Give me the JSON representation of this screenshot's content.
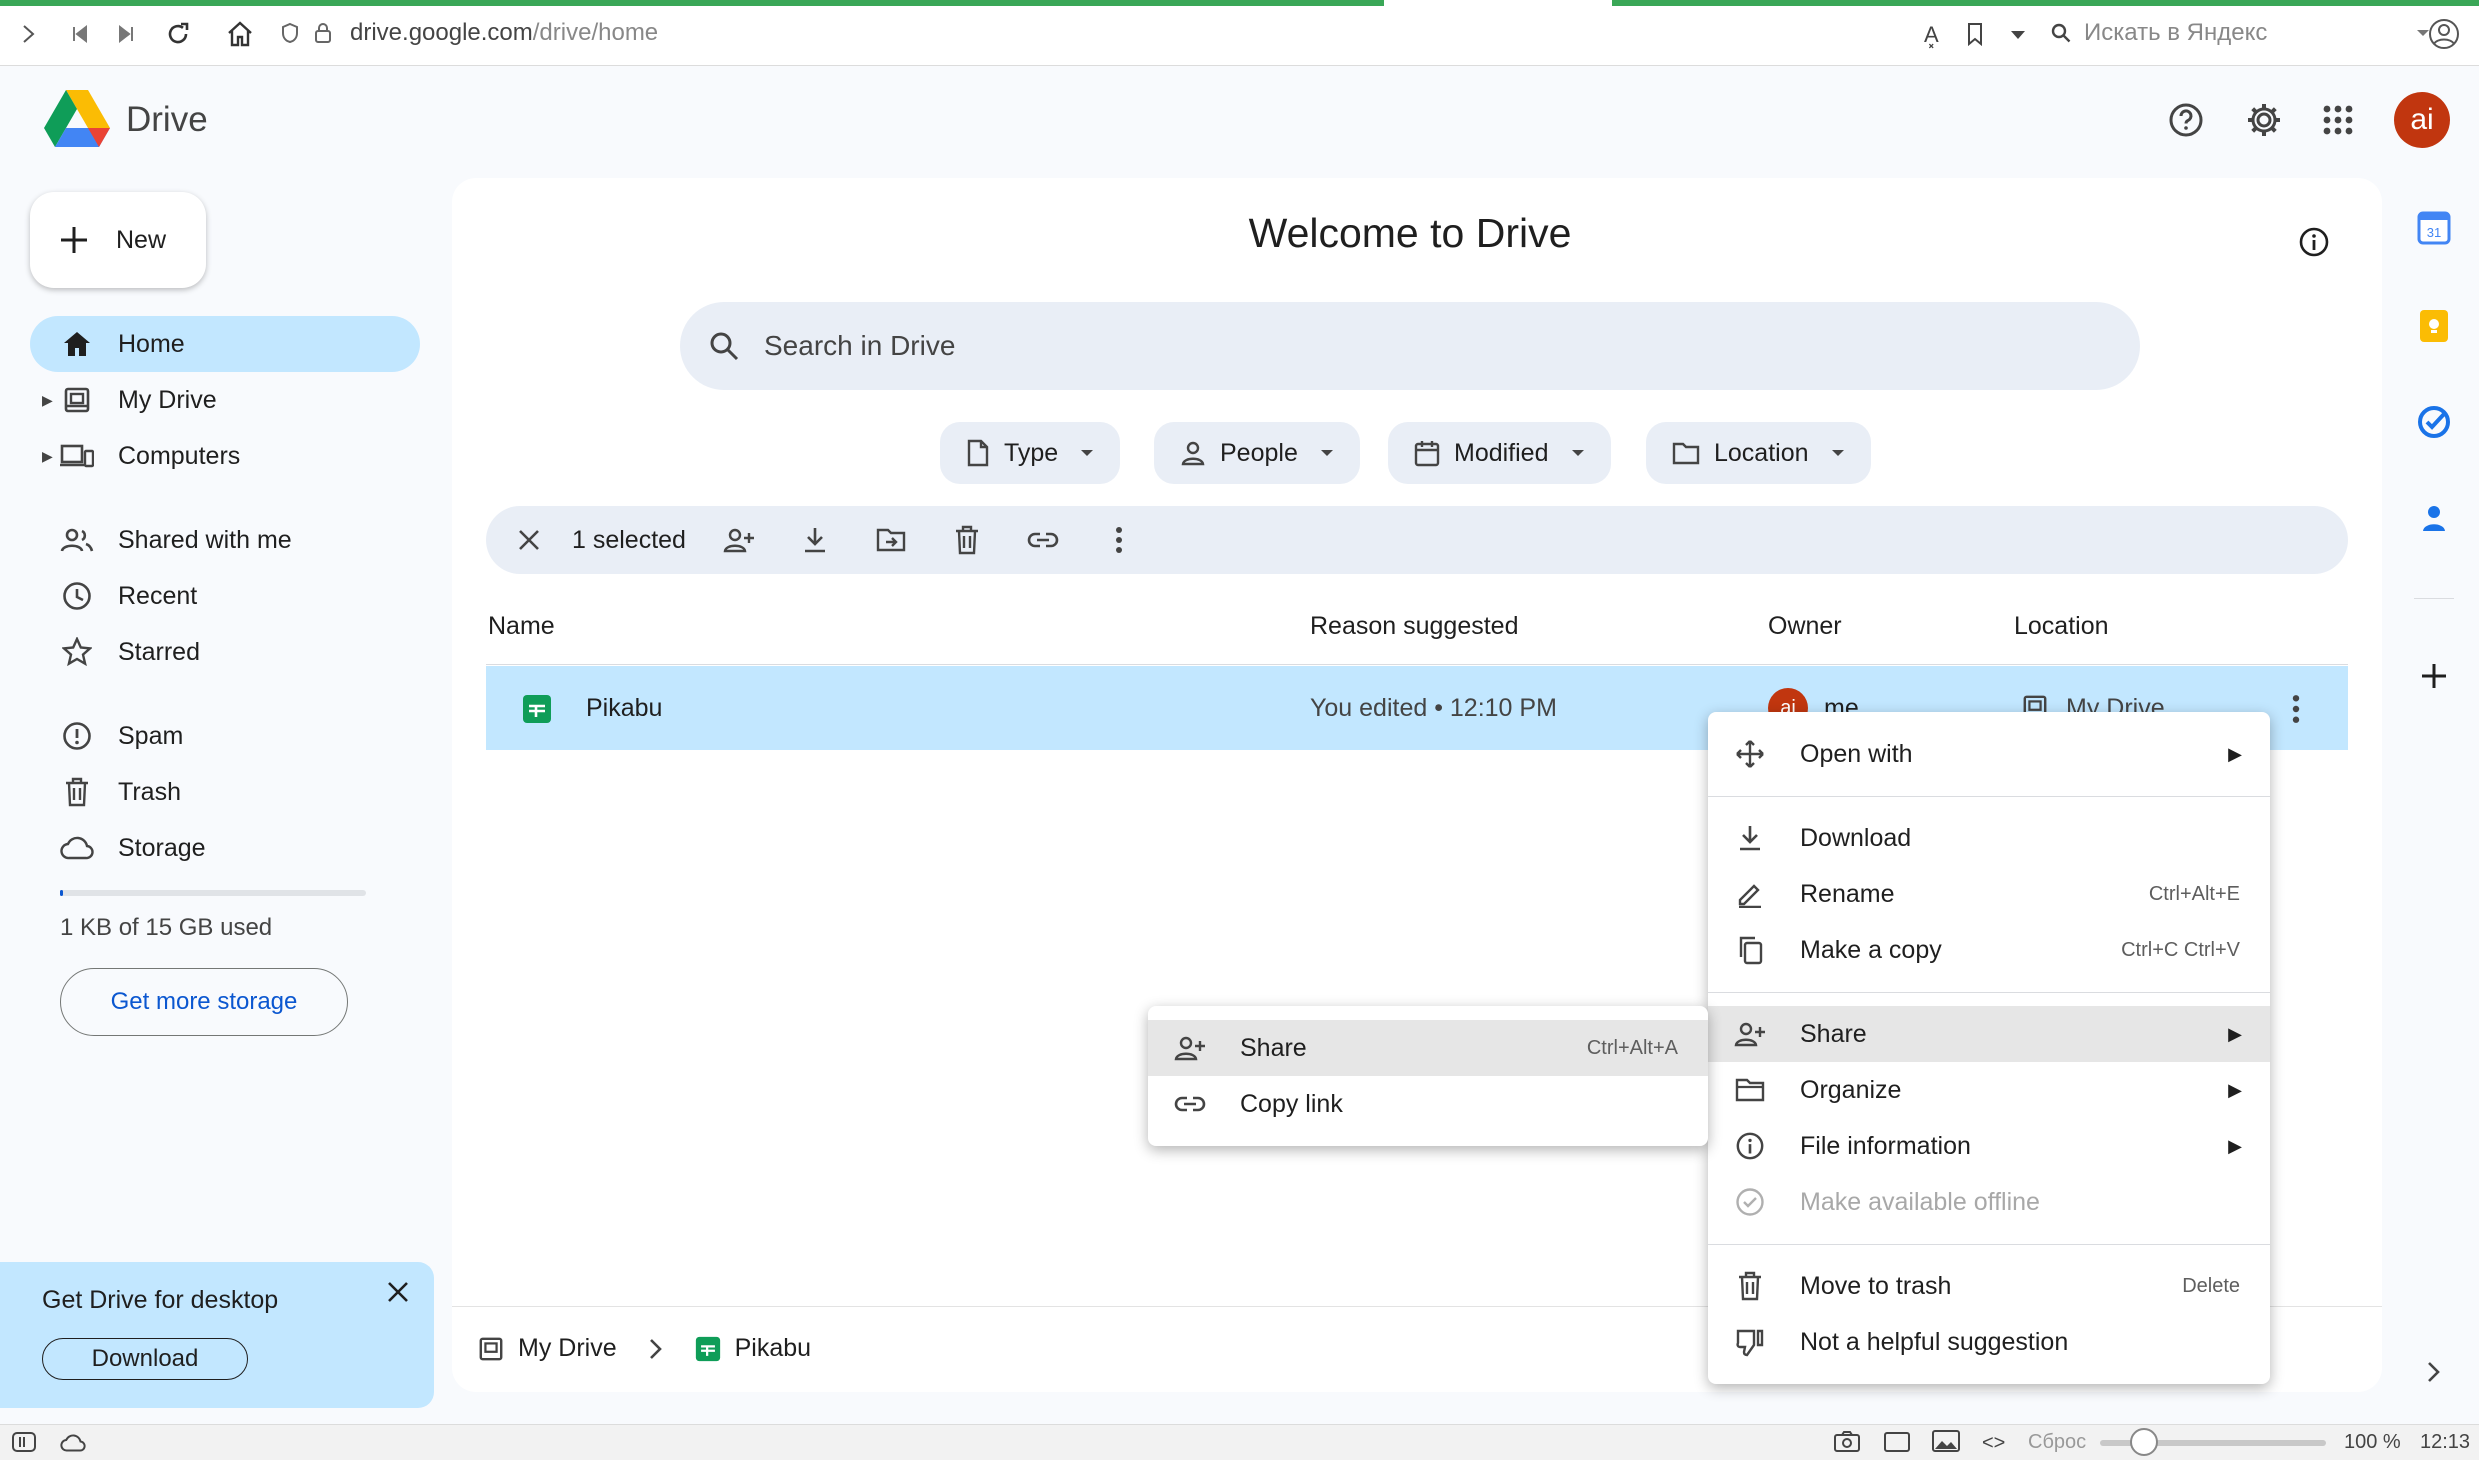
{
  "browser": {
    "url_prefix": "drive.google.com",
    "url_path": "/drive/home",
    "search_placeholder": "Искать в Яндекс",
    "status": {
      "reset": "Сброс",
      "zoom": "100 %",
      "clock": "12:13"
    }
  },
  "header": {
    "app_name": "Drive",
    "avatar_initials": "ai"
  },
  "sidebar": {
    "new_label": "New",
    "items": [
      {
        "label": "Home",
        "icon": "home-icon"
      },
      {
        "label": "My Drive",
        "icon": "my-drive-icon"
      },
      {
        "label": "Computers",
        "icon": "computers-icon"
      },
      {
        "label": "Shared with me",
        "icon": "shared-icon"
      },
      {
        "label": "Recent",
        "icon": "clock-icon"
      },
      {
        "label": "Starred",
        "icon": "star-icon"
      },
      {
        "label": "Spam",
        "icon": "spam-icon"
      },
      {
        "label": "Trash",
        "icon": "trash-icon"
      },
      {
        "label": "Storage",
        "icon": "cloud-icon"
      }
    ],
    "storage_used": "1 KB of 15 GB used",
    "get_more_storage": "Get more storage",
    "promo": {
      "title": "Get Drive for desktop",
      "download": "Download"
    }
  },
  "main": {
    "title": "Welcome to Drive",
    "search_placeholder": "Search in Drive",
    "filters": [
      "Type",
      "People",
      "Modified",
      "Location"
    ],
    "selection": {
      "count_label": "1 selected"
    },
    "columns": {
      "name": "Name",
      "reason": "Reason suggested",
      "owner": "Owner",
      "location": "Location"
    },
    "row": {
      "name": "Pikabu",
      "reason": "You edited • 12:10 PM",
      "owner_initials": "ai",
      "owner": "me",
      "location": "My Drive"
    },
    "breadcrumb": [
      "My Drive",
      "Pikabu"
    ]
  },
  "context_menu": {
    "items": [
      {
        "label": "Open with",
        "icon": "move-icon",
        "shortcut": ""
      },
      {
        "label": "Download",
        "icon": "download-icon",
        "shortcut": ""
      },
      {
        "label": "Rename",
        "icon": "rename-icon",
        "shortcut": "Ctrl+Alt+E"
      },
      {
        "label": "Make a copy",
        "icon": "copy-icon",
        "shortcut": "Ctrl+C Ctrl+V"
      },
      {
        "label": "Share",
        "icon": "share-icon",
        "shortcut": ""
      },
      {
        "label": "Organize",
        "icon": "folder-icon",
        "shortcut": ""
      },
      {
        "label": "File information",
        "icon": "info-icon",
        "shortcut": ""
      },
      {
        "label": "Make available offline",
        "icon": "offline-icon",
        "shortcut": ""
      },
      {
        "label": "Move to trash",
        "icon": "trash-icon",
        "shortcut": "Delete"
      },
      {
        "label": "Not a helpful suggestion",
        "icon": "thumbs-down-icon",
        "shortcut": ""
      }
    ]
  },
  "submenu": {
    "items": [
      {
        "label": "Share",
        "shortcut": "Ctrl+Alt+A"
      },
      {
        "label": "Copy link",
        "shortcut": ""
      }
    ]
  },
  "colors": {
    "accent": "#0b57d0",
    "selected": "#c2e7ff",
    "avatar": "#c1360f",
    "sheets_green": "#0f9d58"
  }
}
